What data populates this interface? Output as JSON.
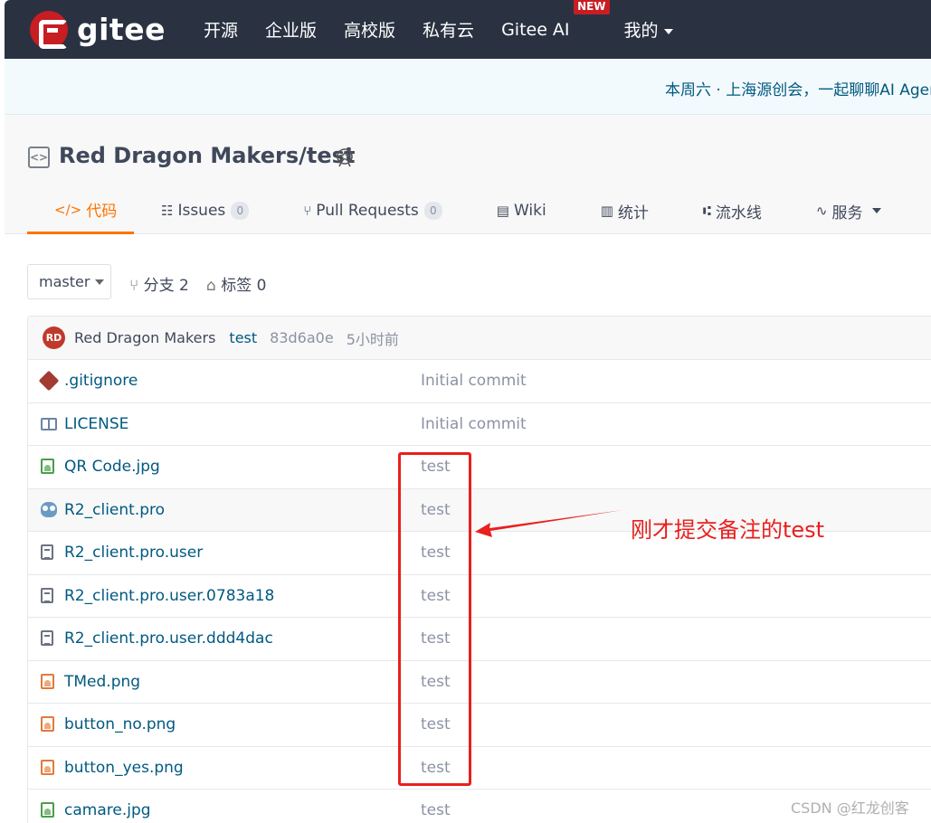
{
  "nav": {
    "logo_text": "gitee",
    "items": [
      "开源",
      "企业版",
      "高校版",
      "私有云",
      "Gitee AI",
      "我的"
    ],
    "new_badge": "NEW"
  },
  "banner": {
    "text": "本周六 · 上海源创会，一起聊聊AI Agen"
  },
  "project": {
    "title": "Red Dragon Makers/test",
    "tabs": [
      {
        "label": "代码",
        "icon": "code-icon"
      },
      {
        "label": "Issues",
        "icon": "issues-icon",
        "count": "0"
      },
      {
        "label": "Pull Requests",
        "icon": "pull-request-icon",
        "count": "0"
      },
      {
        "label": "Wiki",
        "icon": "wiki-icon"
      },
      {
        "label": "统计",
        "icon": "stats-icon"
      },
      {
        "label": "流水线",
        "icon": "pipeline-icon"
      },
      {
        "label": "服务",
        "icon": "service-icon"
      }
    ]
  },
  "branch": {
    "selected": "master",
    "branches_label": "分支 2",
    "tags_label": "标签 0"
  },
  "last_commit": {
    "avatar": "RD",
    "author": "Red Dragon Makers",
    "message": "test",
    "sha": "83d6a0e",
    "time": "5小时前"
  },
  "files": [
    {
      "name": ".gitignore",
      "commit": "Initial commit",
      "icon": "git-icon"
    },
    {
      "name": "LICENSE",
      "commit": "Initial commit",
      "icon": "book-icon"
    },
    {
      "name": "QR Code.jpg",
      "commit": "test",
      "icon": "image-icon"
    },
    {
      "name": "R2_client.pro",
      "commit": "test",
      "icon": "qt-project-icon"
    },
    {
      "name": "R2_client.pro.user",
      "commit": "test",
      "icon": "file-icon"
    },
    {
      "name": "R2_client.pro.user.0783a18",
      "commit": "test",
      "icon": "file-icon"
    },
    {
      "name": "R2_client.pro.user.ddd4dac",
      "commit": "test",
      "icon": "file-icon"
    },
    {
      "name": "TMed.png",
      "commit": "test",
      "icon": "png-image-icon"
    },
    {
      "name": "button_no.png",
      "commit": "test",
      "icon": "png-image-icon"
    },
    {
      "name": "button_yes.png",
      "commit": "test",
      "icon": "png-image-icon"
    },
    {
      "name": "camare.jpg",
      "commit": "test",
      "icon": "image-icon"
    }
  ],
  "annotation": {
    "text": "刚才提交备注的test",
    "color": "#e8201e"
  },
  "watermark": "CSDN @红龙创客",
  "colors": {
    "nav_bg": "#2a3242",
    "brand": "#c71d23",
    "accent": "#fe7300",
    "link": "#005980"
  }
}
